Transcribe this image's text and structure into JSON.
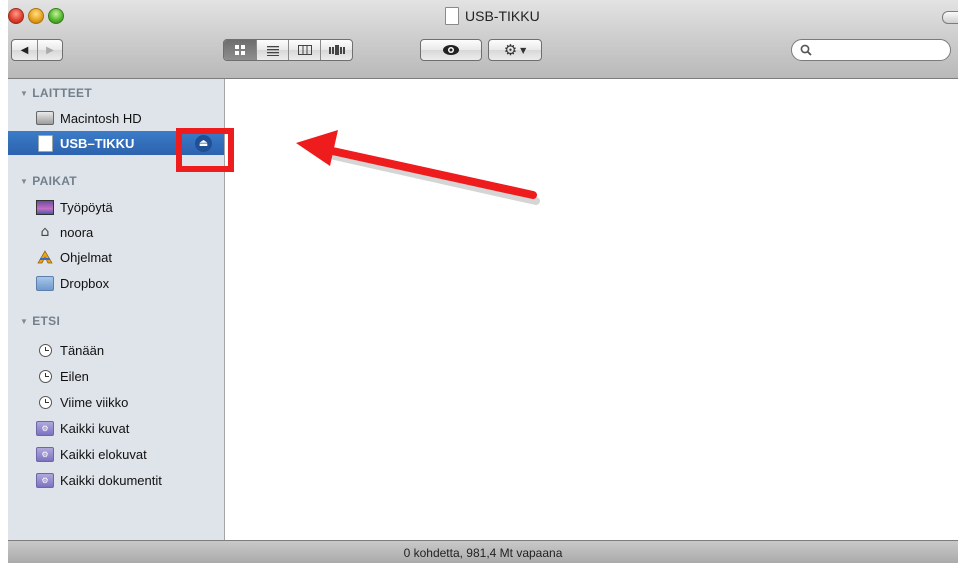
{
  "window": {
    "title": "USB-TIKKU"
  },
  "toolbar": {
    "back_icon": "◀",
    "forward_icon": "▶",
    "view_icons": [
      "icon-view-icon",
      "list-view-icon",
      "column-view-icon",
      "coverflow-view-icon"
    ],
    "quicklook_icon": "eye-icon",
    "action_icon": "gear-icon",
    "search_placeholder": ""
  },
  "sidebar": {
    "sections": [
      {
        "header": "LAITTEET",
        "items": [
          {
            "label": "Macintosh HD",
            "icon": "hard-drive-icon"
          },
          {
            "label": "USB–TIKKU",
            "icon": "usb-drive-icon",
            "selected": true,
            "eject": true
          }
        ]
      },
      {
        "header": "PAIKAT",
        "items": [
          {
            "label": "Työpöytä",
            "icon": "desktop-icon"
          },
          {
            "label": "noora",
            "icon": "home-icon"
          },
          {
            "label": "Ohjelmat",
            "icon": "applications-icon"
          },
          {
            "label": "Dropbox",
            "icon": "folder-icon"
          }
        ]
      },
      {
        "header": "ETSI",
        "items": [
          {
            "label": "Tänään",
            "icon": "clock-icon"
          },
          {
            "label": "Eilen",
            "icon": "clock-icon"
          },
          {
            "label": "Viime viikko",
            "icon": "clock-icon"
          },
          {
            "label": "Kaikki kuvat",
            "icon": "smart-folder-icon"
          },
          {
            "label": "Kaikki elokuvat",
            "icon": "smart-folder-icon"
          },
          {
            "label": "Kaikki dokumentit",
            "icon": "smart-folder-icon"
          }
        ]
      }
    ]
  },
  "status": {
    "text": "0 kohdetta, 981,4 Mt vapaana"
  },
  "annotation": {
    "color": "#ee1c1c"
  }
}
